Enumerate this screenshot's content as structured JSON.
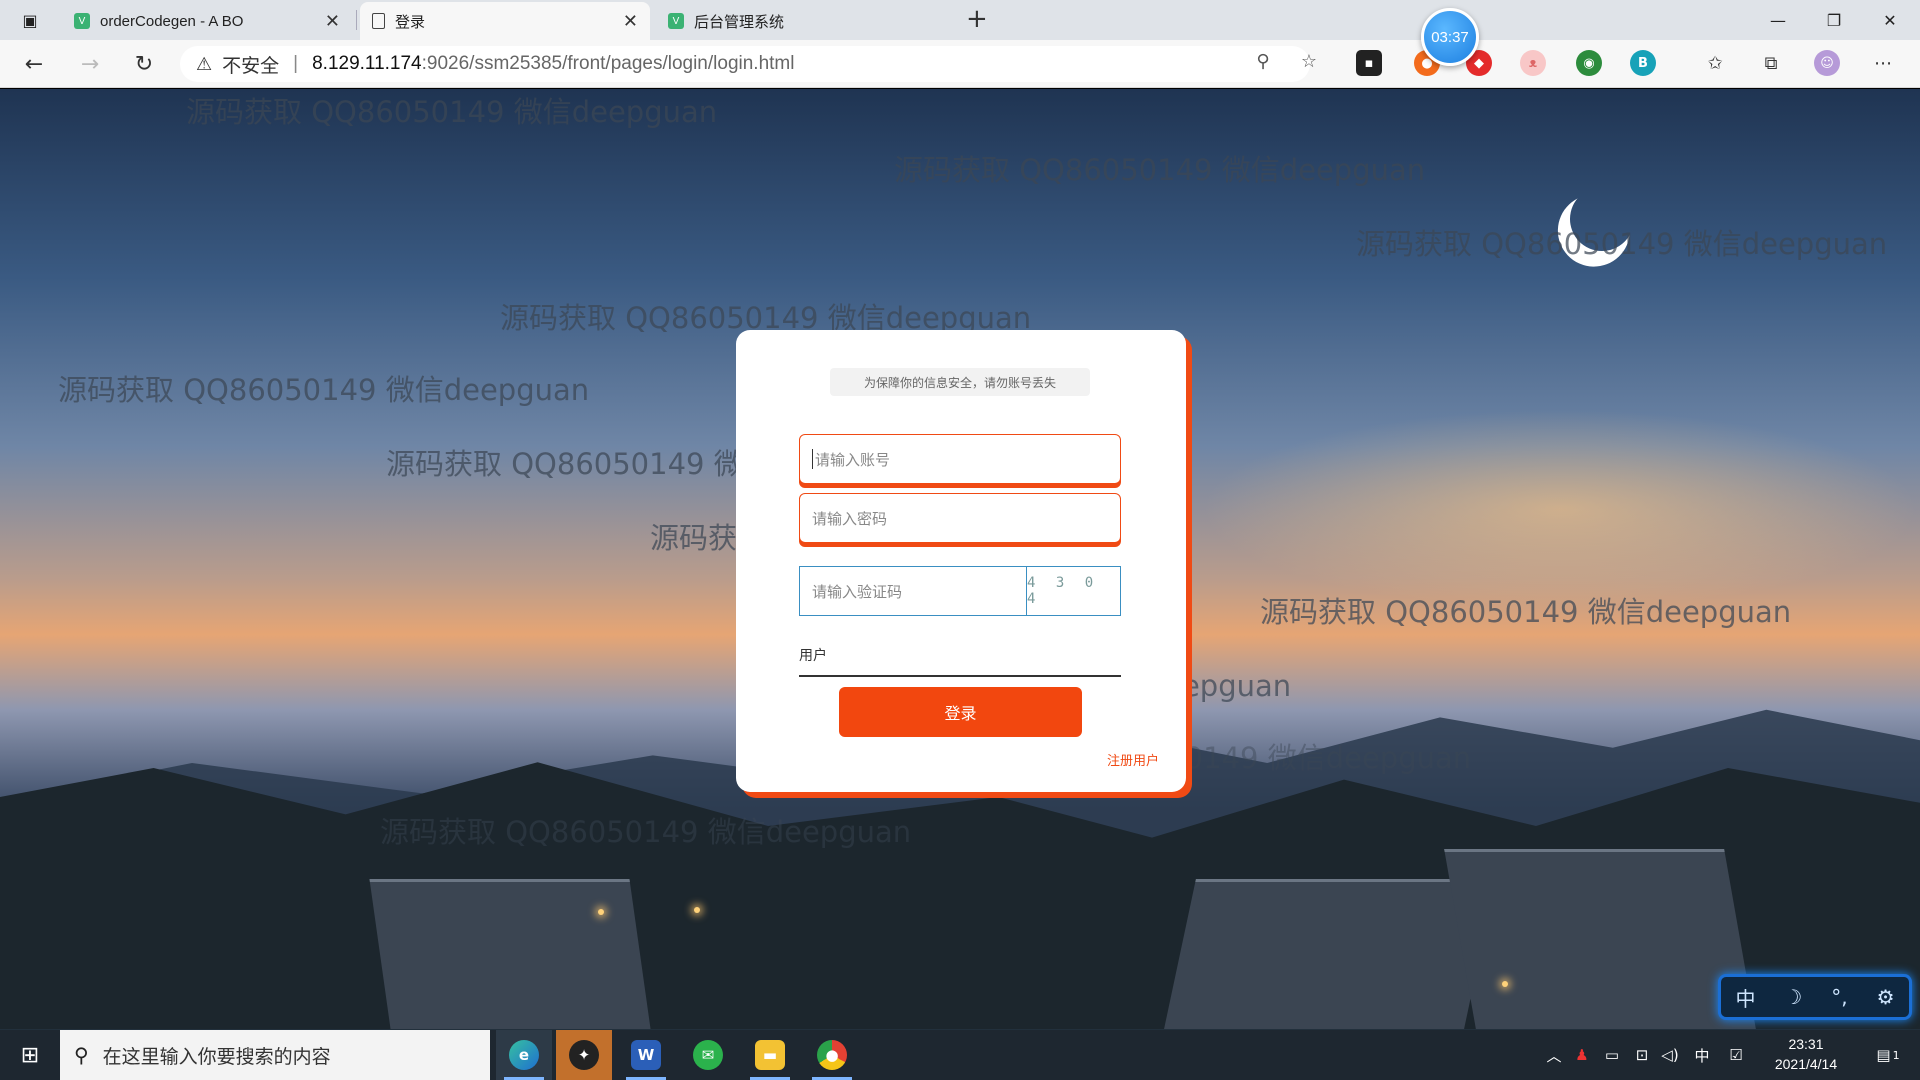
{
  "browser": {
    "tabs": [
      {
        "title": "orderCodegen - A BO",
        "active": false
      },
      {
        "title": "登录",
        "active": true
      },
      {
        "title": "后台管理系统",
        "active": false
      }
    ],
    "new_tab": "+",
    "window_controls": {
      "minimize": "—",
      "restore": "❐",
      "close": "✕"
    },
    "address": {
      "security_label": "不安全",
      "host": "8.129.11.174",
      "path": ":9026/ssm25385/front/pages/login/login.html"
    },
    "timer": "03:37"
  },
  "watermark_text": "源码获取 QQ86050149 微信deepguan",
  "login": {
    "notice": "为保障你的信息安全，请勿账号丢失",
    "username_placeholder": "请输入账号",
    "password_placeholder": "请输入密码",
    "captcha_placeholder": "请输入验证码",
    "captcha_code": "4 3 0 4",
    "role_label": "用户",
    "login_button": "登录",
    "register_link": "注册用户"
  },
  "ime_widget": {
    "lang": "中",
    "moon": "☽",
    "punct": "°,",
    "settings": "⚙"
  },
  "taskbar": {
    "search_placeholder": "在这里输入你要搜索的内容",
    "apps": [
      "edge",
      "app",
      "word",
      "wechat",
      "explorer",
      "chrome"
    ],
    "tray_lang": "中",
    "time": "23:31",
    "date": "2021/4/14",
    "notification_count": "1"
  },
  "colors": {
    "accent": "#f04a14",
    "button": "#f2470f",
    "captcha_border": "#3a8fc2"
  }
}
